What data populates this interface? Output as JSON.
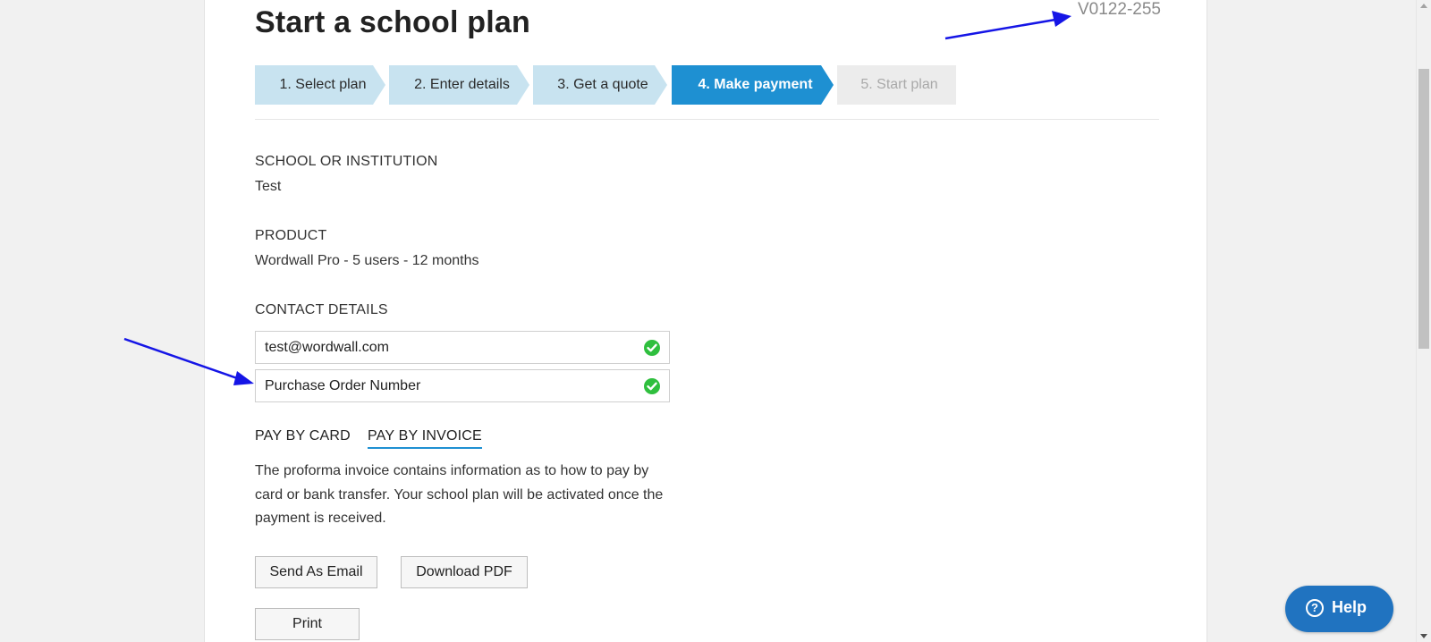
{
  "header": {
    "title": "Start a school plan",
    "version": "V0122-255"
  },
  "steps": [
    {
      "label": "1. Select plan",
      "state": "done"
    },
    {
      "label": "2. Enter details",
      "state": "done"
    },
    {
      "label": "3. Get a quote",
      "state": "done"
    },
    {
      "label": "4. Make payment",
      "state": "active"
    },
    {
      "label": "5. Start plan",
      "state": "future"
    }
  ],
  "school": {
    "label": "SCHOOL OR INSTITUTION",
    "value": "Test"
  },
  "product": {
    "label": "PRODUCT",
    "value": "Wordwall Pro - 5 users - 12 months"
  },
  "contact": {
    "label": "CONTACT DETAILS",
    "email": "test@wordwall.com",
    "po_number": "Purchase Order Number"
  },
  "payment_tabs": {
    "card": "PAY BY CARD",
    "invoice": "PAY BY INVOICE",
    "active": "invoice"
  },
  "invoice": {
    "description": "The proforma invoice contains information as to how to pay by card or bank transfer. Your school plan will be activated once the payment is received.",
    "send_email": "Send As Email",
    "download_pdf": "Download PDF",
    "print": "Print"
  },
  "help": {
    "label": "Help",
    "icon": "question-circle-icon"
  },
  "colors": {
    "accent": "#1e90d2",
    "step_done": "#c8e3f0",
    "check": "#2fbf3e",
    "help_button": "#2073c0",
    "annotation_arrow": "#1515e6"
  }
}
